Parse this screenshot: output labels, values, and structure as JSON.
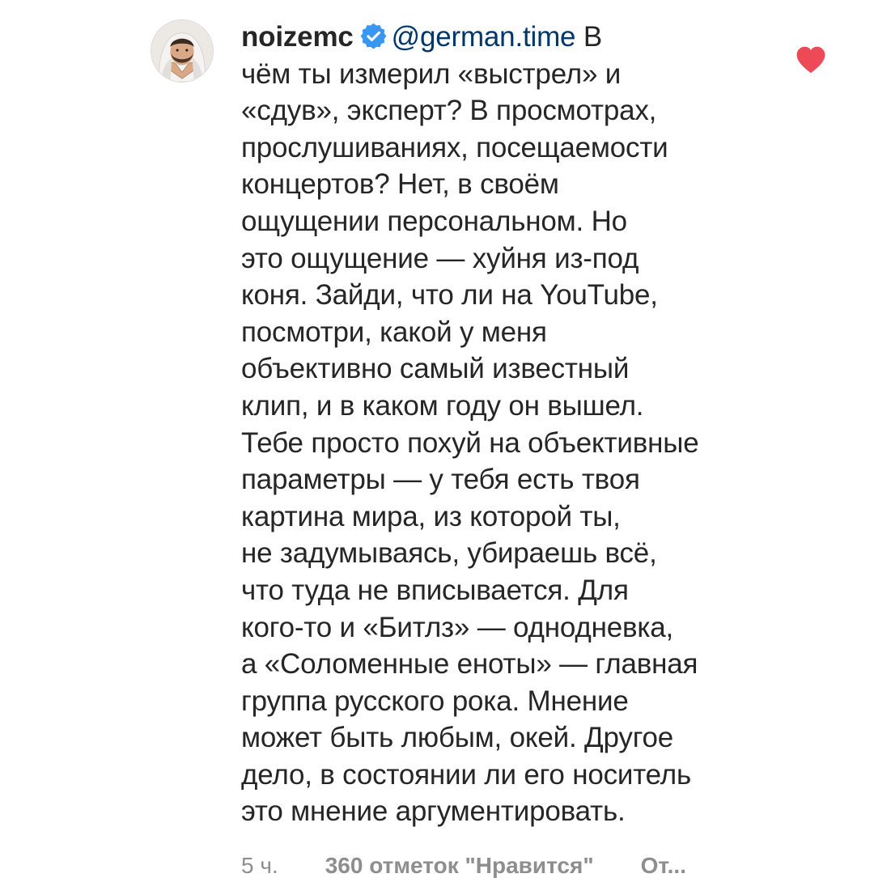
{
  "comment": {
    "username": "noizemc",
    "verified": true,
    "mention": "@german.time",
    "lines": [
      "В",
      "чём ты измерил «выстрел» и",
      "«сдув», эксперт? В просмотрах,",
      "прослушиваниях, посещаемости",
      "концертов? Нет, в своём",
      "ощущении персональном. Но",
      "это ощущение — хуйня из-под",
      "коня. Зайди, что ли на YouTube,",
      "посмотри, какой у меня",
      "объективно самый известный",
      "клип, и в каком году он вышел.",
      "Тебе просто похуй на объективные",
      "параметры — у тебя есть твоя",
      "картина мира, из которой ты,",
      "не задумываясь, убираешь всё,",
      "что туда не вписывается. Для",
      "кого-то и «Битлз» — однодневка,",
      "а «Соломенные еноты» — главная",
      "группа русского рока. Мнение",
      "может быть любым, окей. Другое",
      "дело, в состоянии ли его носитель",
      "это мнение аргументировать."
    ],
    "time": "5 ч.",
    "likes": "360 отметок \"Нравится\"",
    "reply": "От..."
  },
  "icons": {
    "avatar": "profile-photo",
    "verified": "verified-badge-icon",
    "like": "heart-icon"
  },
  "colors": {
    "text": "#262626",
    "mention": "#00376b",
    "meta": "#8e8e8e",
    "verified": "#3897f0",
    "heart": "#ed4956"
  }
}
